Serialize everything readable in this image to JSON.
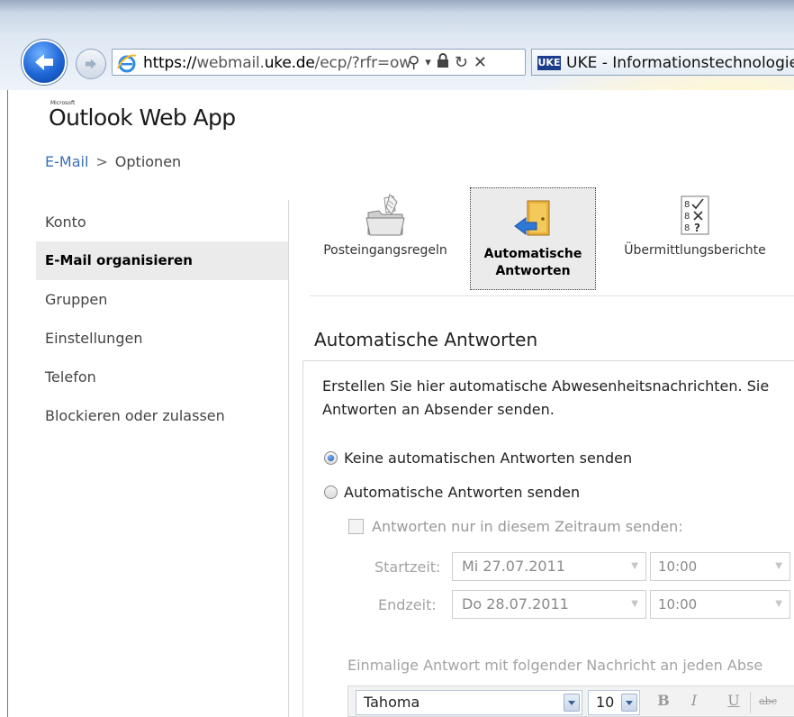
{
  "browser": {
    "url_scheme": "https://",
    "url_pre": "webmail.",
    "url_domain": "uke.de",
    "url_path": "/ecp/?rfr=ow",
    "search_glyph": "⚲",
    "dropdown_glyph": "▾",
    "lock_glyph": "🔒",
    "refresh_glyph": "↻",
    "stop_glyph": "✕",
    "tab_logo": "UKE",
    "tab_title": "UKE - Informationstechnologie..."
  },
  "app": {
    "ms_label": "Microsoft",
    "title": "Outlook Web App"
  },
  "breadcrumb": {
    "link": "E-Mail",
    "separator": ">",
    "current": "Optionen"
  },
  "nav": {
    "items": [
      {
        "label": "Konto"
      },
      {
        "label": "E-Mail organisieren",
        "active": true
      },
      {
        "label": "Gruppen"
      },
      {
        "label": "Einstellungen"
      },
      {
        "label": "Telefon"
      },
      {
        "label": "Blockieren oder zulassen"
      }
    ]
  },
  "toolbar": {
    "rules_label": "Posteingangsregeln",
    "auto_label_1": "Automatische",
    "auto_label_2": "Antworten",
    "reports_label": "Übermittlungsberichte"
  },
  "content": {
    "title": "Automatische Antworten",
    "desc_line1": "Erstellen Sie hier automatische Abwesenheitsnachrichten. Sie",
    "desc_line2": "Antworten an Absender senden.",
    "radio_none": "Keine automatischen Antworten senden",
    "radio_send": "Automatische Antworten senden",
    "selected_option": "none",
    "period_checkbox": "Antworten nur in diesem Zeitraum senden:",
    "start_label": "Startzeit:",
    "start_date": "Mi 27.07.2011",
    "start_time": "10:00",
    "end_label": "Endzeit:",
    "end_date": "Do 28.07.2011",
    "end_time": "10:00",
    "oneoff_text": "Einmalige Antwort mit folgender Nachricht an jeden Abse"
  },
  "editor": {
    "font": "Tahoma",
    "size": "10",
    "bold": "B",
    "italic": "I",
    "underline": "U",
    "strike": "abc"
  },
  "colors": {
    "accent_link": "#3a6fb5",
    "nav_active_bg": "#ebebeb"
  }
}
